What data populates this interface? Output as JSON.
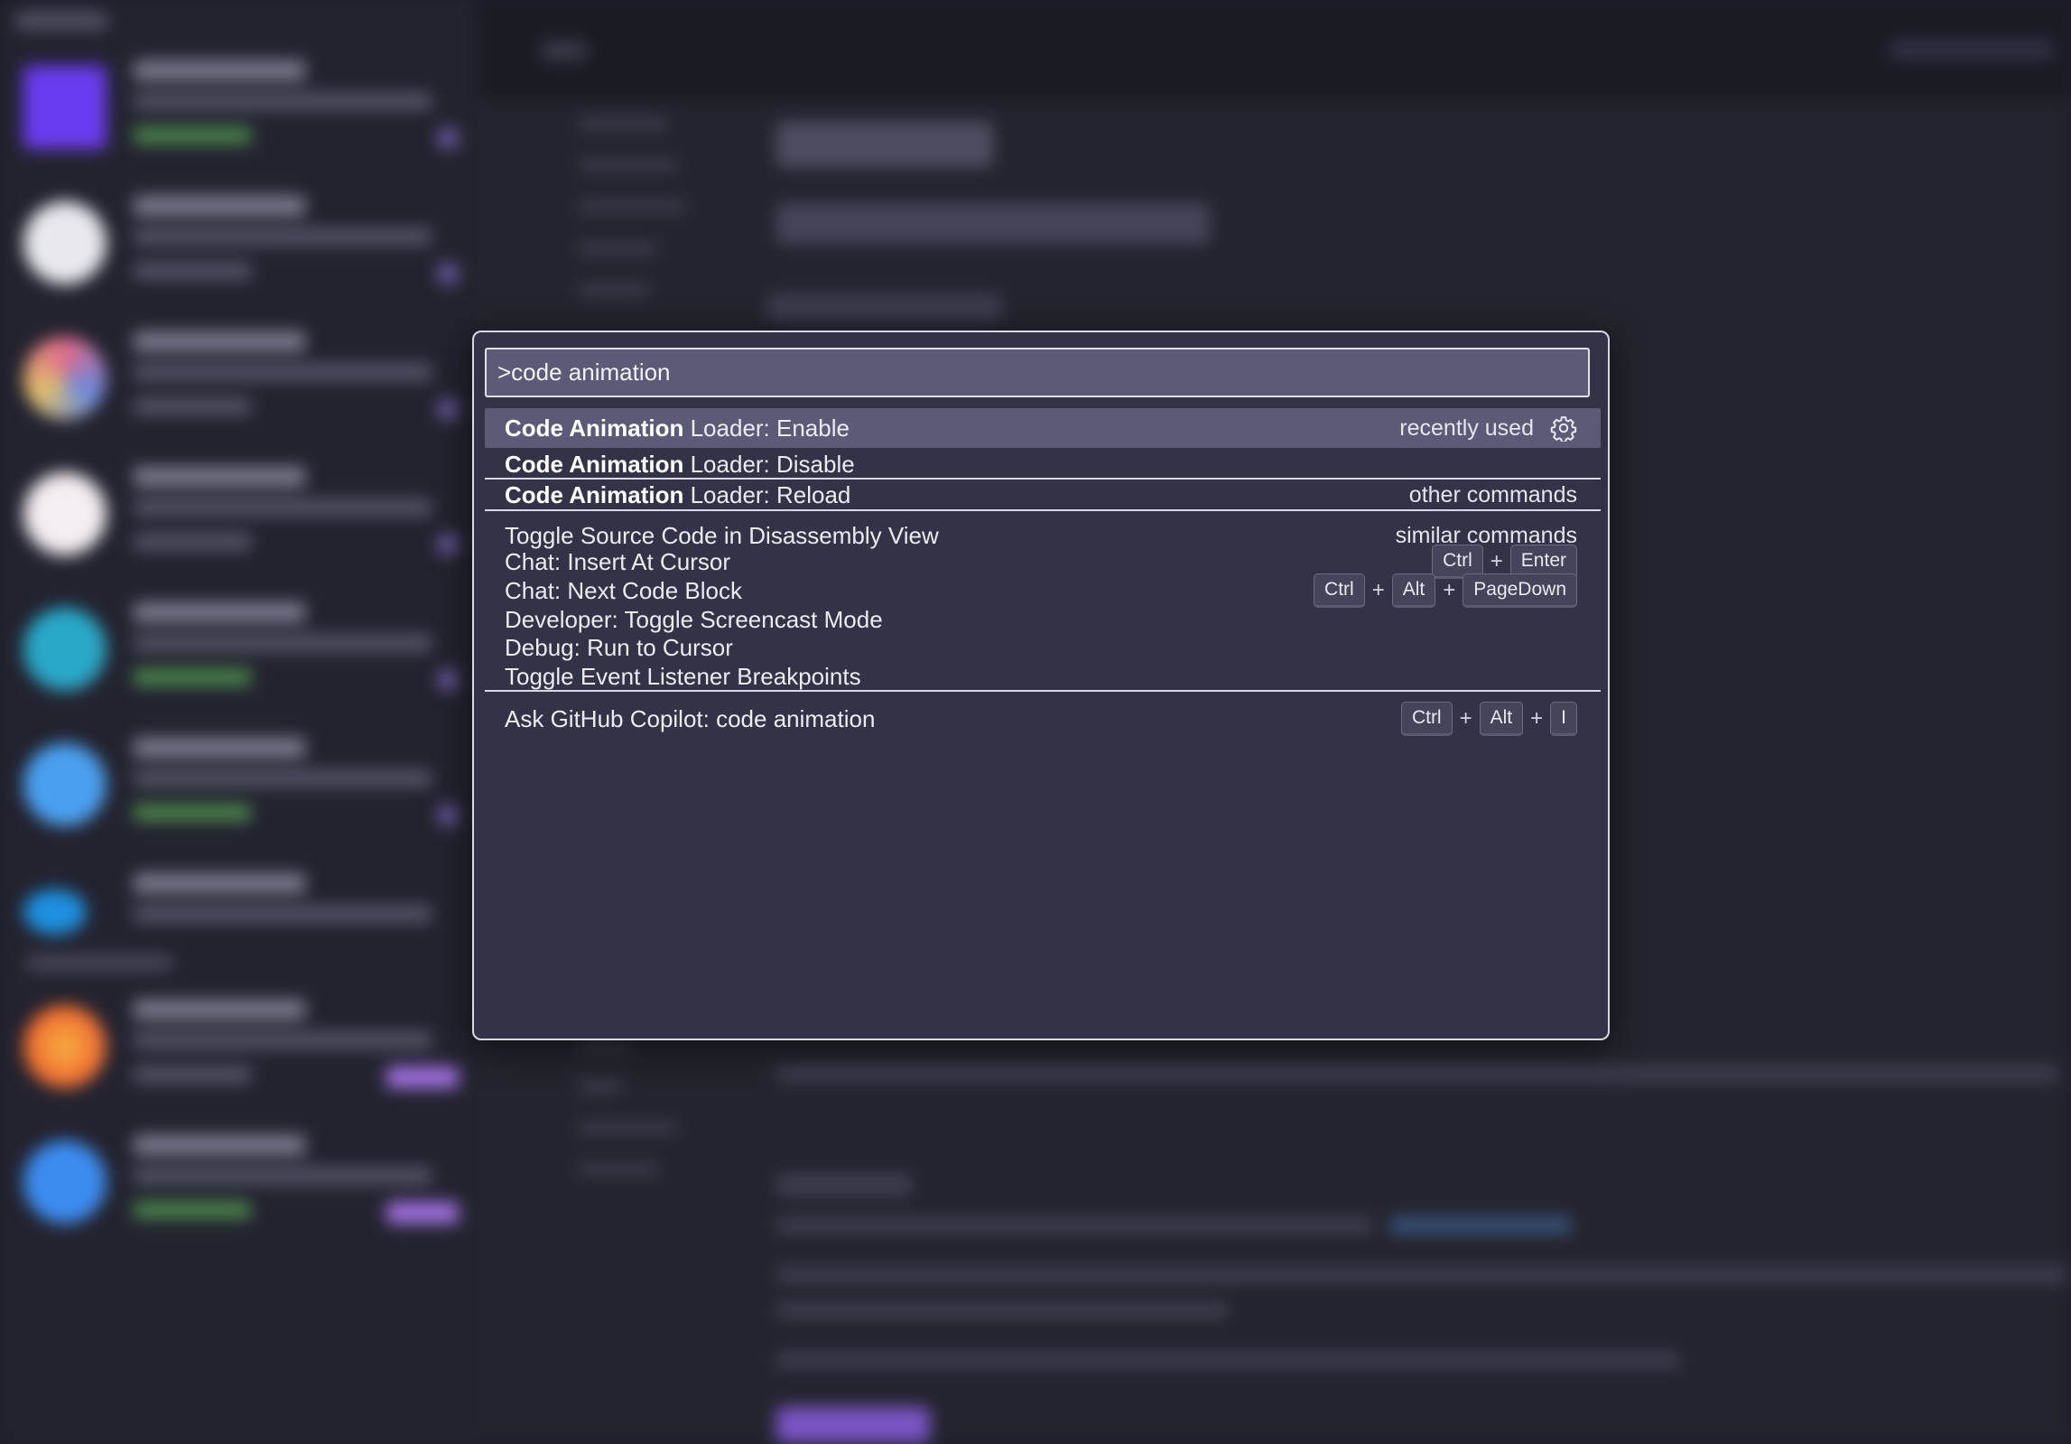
{
  "colors": {
    "palette_bg": "#333347",
    "palette_border": "#d8d8e4",
    "selected_row_bg": "#5b5b77",
    "input_bg": "#5b5b77",
    "highlight_text": "#ffffff",
    "accent_purple": "#7a55c4"
  },
  "command_palette": {
    "input_value": ">code animation",
    "items": [
      {
        "highlight": "Code Animation",
        "rest": " Loader: Enable",
        "right_text": "recently used",
        "icon": "gear-icon",
        "selected": true,
        "separator_after": false,
        "keys": []
      },
      {
        "highlight": "Code Animation",
        "rest": " Loader: Disable",
        "right_text": "",
        "selected": false,
        "separator_after": true,
        "keys": []
      },
      {
        "highlight": "Code Animation",
        "rest": " Loader: Reload",
        "right_text": "other commands",
        "selected": false,
        "separator_after": true,
        "keys": []
      },
      {
        "highlight": "",
        "rest": "Toggle Source Code in Disassembly View",
        "right_text": "similar commands",
        "selected": false,
        "separator_after": false,
        "keys": []
      },
      {
        "highlight": "",
        "rest": "Chat: Insert At Cursor",
        "right_text": "",
        "selected": false,
        "separator_after": false,
        "keys": [
          "Ctrl",
          "Enter"
        ]
      },
      {
        "highlight": "",
        "rest": "Chat: Next Code Block",
        "right_text": "",
        "selected": false,
        "separator_after": false,
        "keys": [
          "Ctrl",
          "Alt",
          "PageDown"
        ]
      },
      {
        "highlight": "",
        "rest": "Developer: Toggle Screencast Mode",
        "right_text": "",
        "selected": false,
        "separator_after": false,
        "keys": []
      },
      {
        "highlight": "",
        "rest": "Debug: Run to Cursor",
        "right_text": "",
        "selected": false,
        "separator_after": false,
        "keys": []
      },
      {
        "highlight": "",
        "rest": "Toggle Event Listener Breakpoints",
        "right_text": "",
        "selected": false,
        "separator_after": true,
        "keys": []
      },
      {
        "highlight": "",
        "rest": "Ask GitHub Copilot: code animation",
        "right_text": "",
        "selected": false,
        "separator_after": false,
        "keys": [
          "Ctrl",
          "Alt",
          "I"
        ]
      }
    ],
    "key_separator": "+"
  }
}
